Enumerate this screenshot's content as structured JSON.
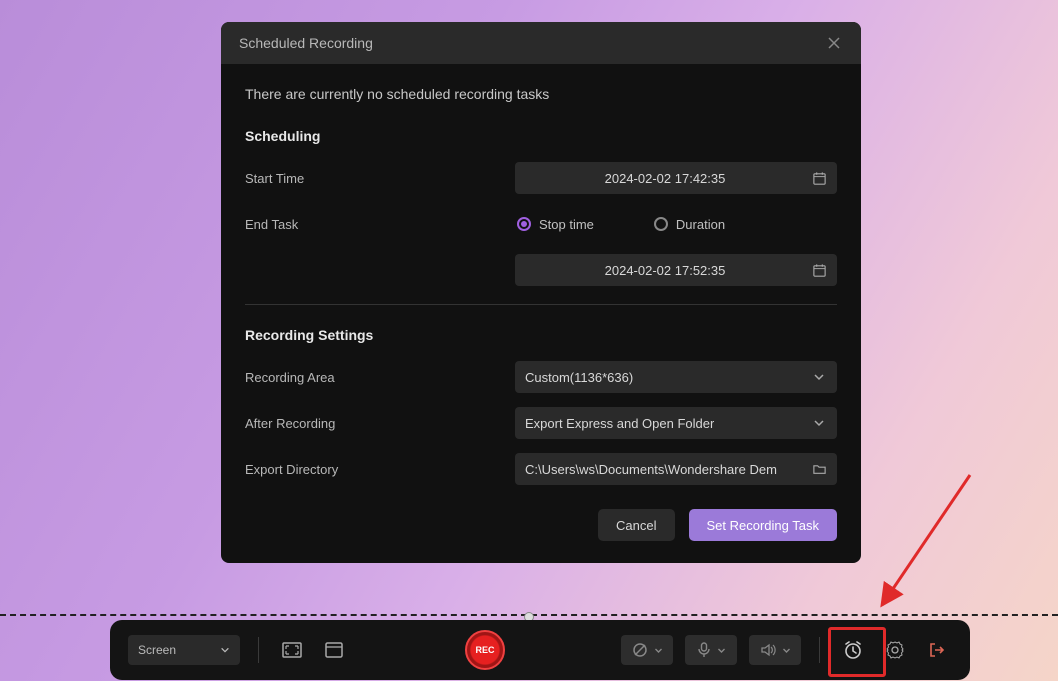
{
  "dialog": {
    "title": "Scheduled Recording",
    "empty_msg": "There are currently no scheduled recording tasks",
    "scheduling_title": "Scheduling",
    "start_time_label": "Start Time",
    "start_time_value": "2024-02-02 17:42:35",
    "end_task_label": "End Task",
    "stop_time_label": "Stop time",
    "duration_label": "Duration",
    "end_time_value": "2024-02-02 17:52:35",
    "recording_settings_title": "Recording Settings",
    "recording_area_label": "Recording Area",
    "recording_area_value": "Custom(1136*636)",
    "after_recording_label": "After Recording",
    "after_recording_value": "Export Express and Open Folder",
    "export_dir_label": "Export Directory",
    "export_dir_value": "C:\\Users\\ws\\Documents\\Wondershare Dem",
    "cancel_label": "Cancel",
    "set_task_label": "Set Recording Task"
  },
  "toolbar": {
    "screen_label": "Screen",
    "rec_label": "REC"
  }
}
